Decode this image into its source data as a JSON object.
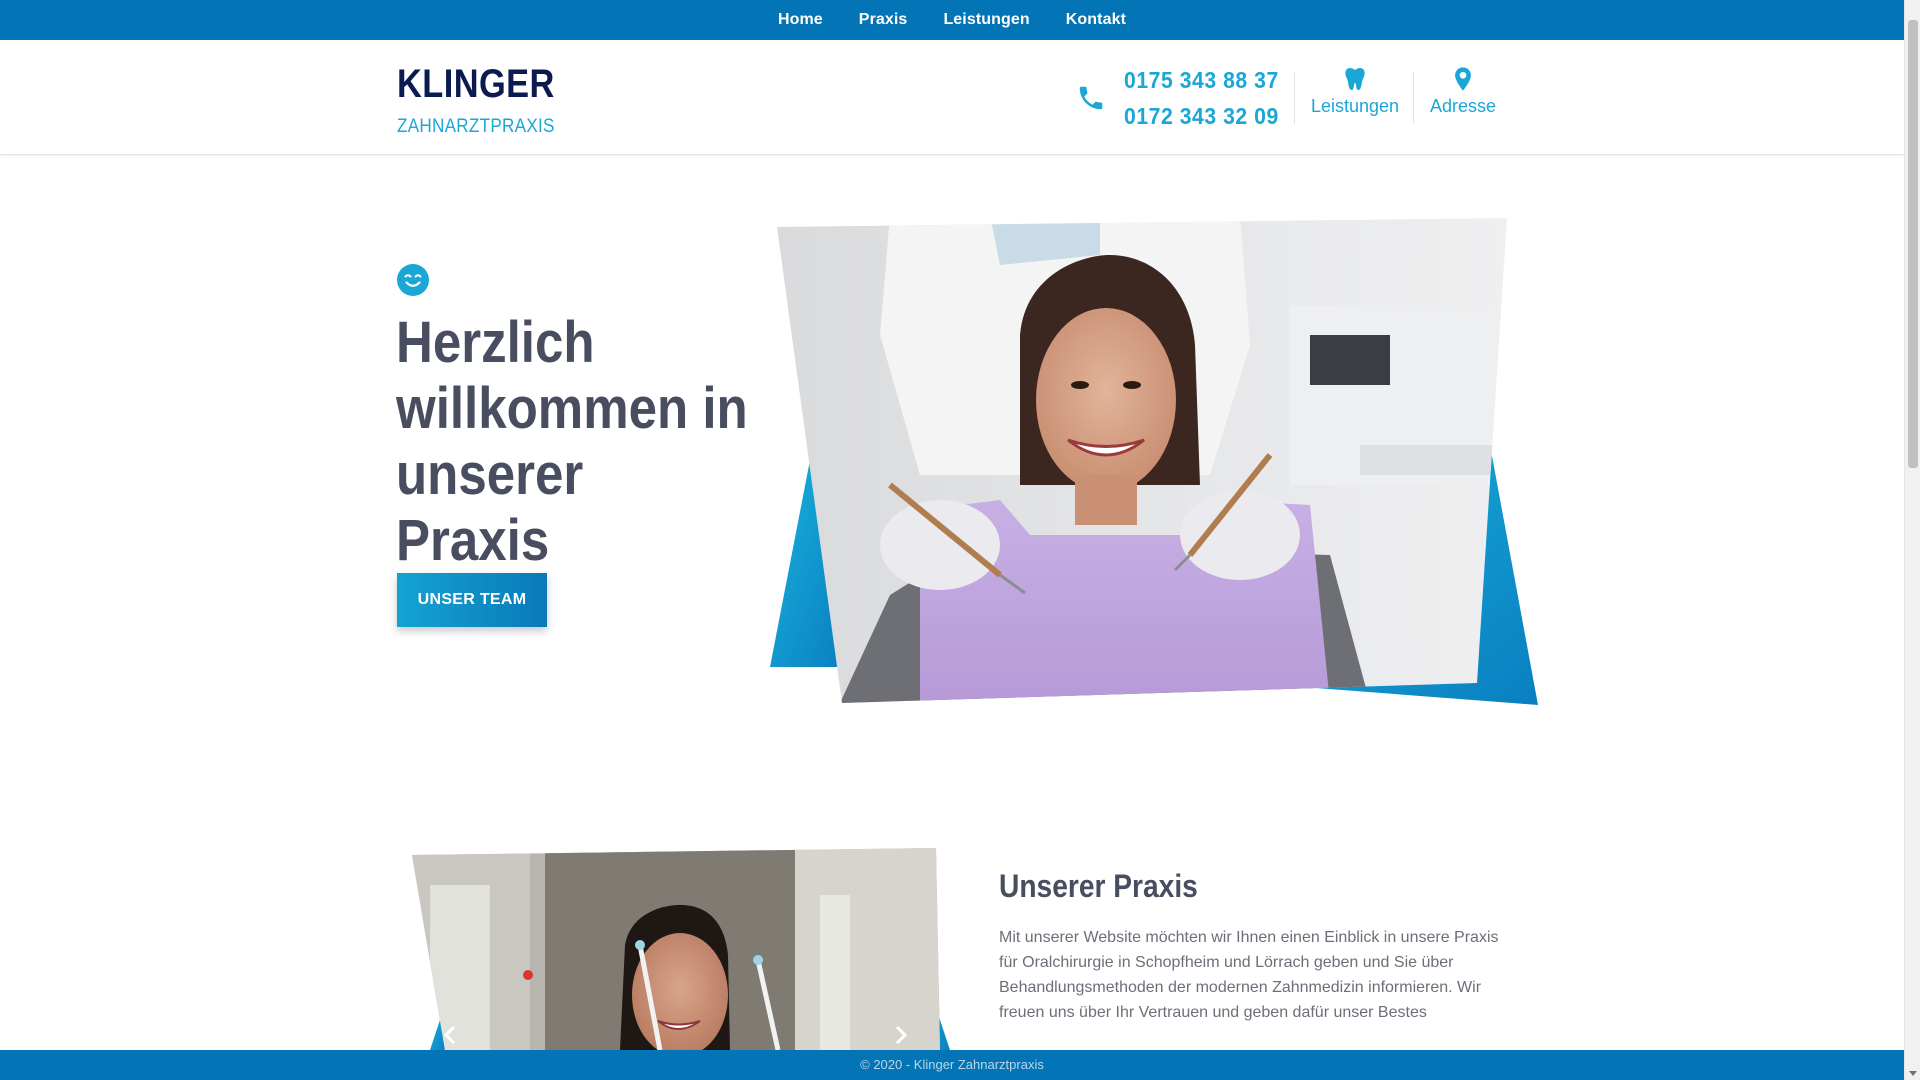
{
  "nav": {
    "items": [
      {
        "label": "Home"
      },
      {
        "label": "Praxis"
      },
      {
        "label": "Leistungen"
      },
      {
        "label": "Kontakt"
      }
    ]
  },
  "header": {
    "brand": "KLINGER",
    "subtitle": "ZAHNARZTPRAXIS",
    "phone_1": "0175 343 88 37",
    "phone_2": "0172 343 32 09",
    "services_label": "Leistungen",
    "address_label": "Adresse"
  },
  "hero": {
    "icon": "smile-icon",
    "title": "Herzlich willkommen in unserer Praxis",
    "button": "UNSER TEAM",
    "image": "dentist-patient-photo"
  },
  "praxis": {
    "title": "Unserer Praxis",
    "text": "Mit unserer Website möchten wir Ihnen einen Einblick in unsere Praxis für Oralchirurgie in Schopfheim und Lörrach geben und Sie über Behandlungsmethoden der modernen Zahnmedizin informieren. Wir freuen uns über Ihr Vertrauen und geben dafür unser Bestes",
    "image": "dental-xray-patient-photo"
  },
  "footer": {
    "text": "© 2020 - Klinger Zahnarztpraxis"
  },
  "colors": {
    "nav_bg": "#0374b5",
    "accent": "#1aa7d6",
    "brand_dark": "#0b1a4f",
    "heading": "#484e60",
    "body_text": "#6a6f78"
  }
}
